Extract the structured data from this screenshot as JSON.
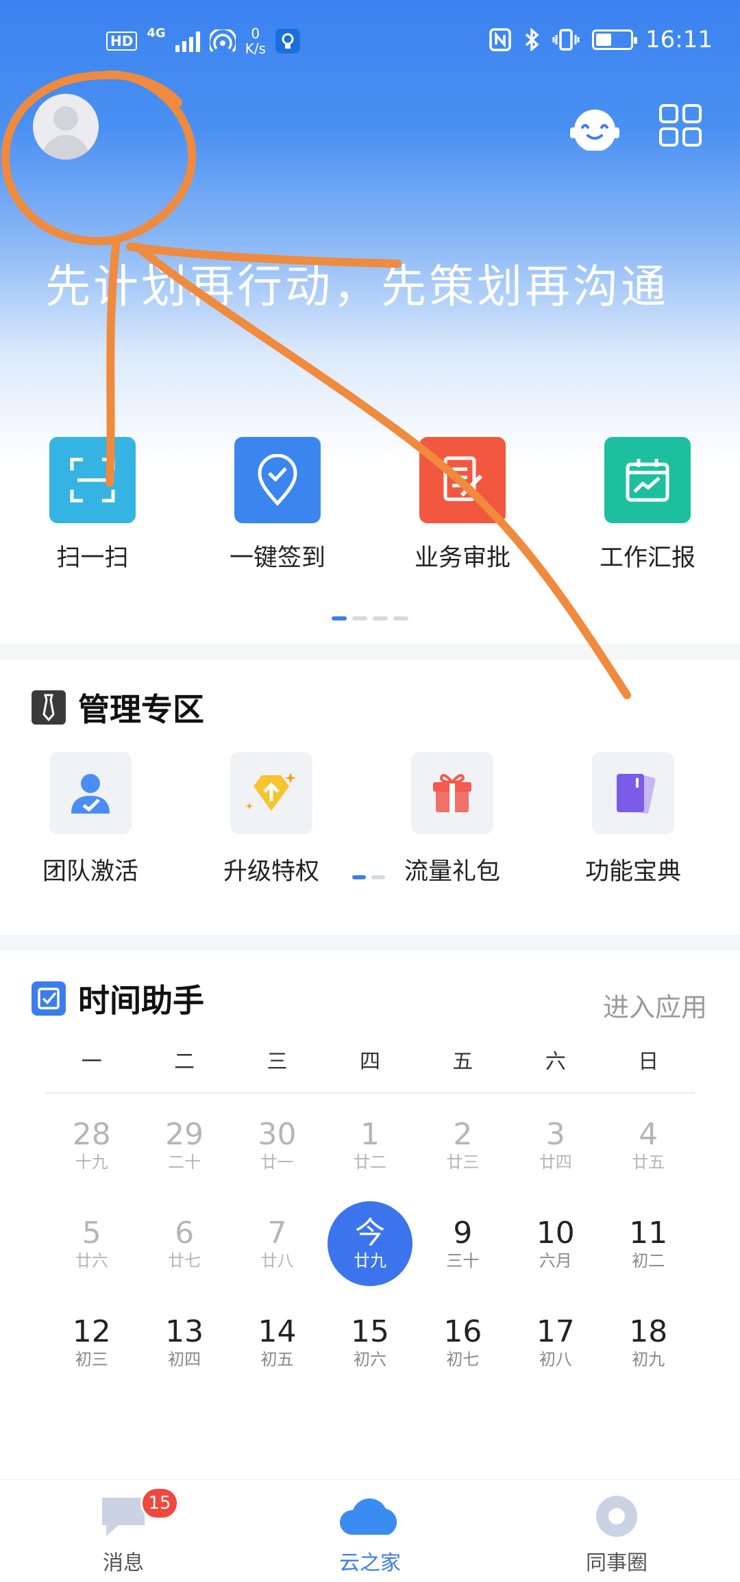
{
  "status_bar": {
    "hd": "HD",
    "network_type": "4G",
    "speed_value": "0",
    "speed_unit": "K/s",
    "time": "16:11",
    "battery_percent": 45
  },
  "header": {
    "slogan": "先计划再行动，先策划再沟通"
  },
  "quick_actions": [
    {
      "label": "扫一扫",
      "icon": "scan-icon",
      "color": "#35b3e2"
    },
    {
      "label": "一键签到",
      "icon": "location-check-icon",
      "color": "#3a86ee"
    },
    {
      "label": "业务审批",
      "icon": "document-edit-icon",
      "color": "#f2573f"
    },
    {
      "label": "工作汇报",
      "icon": "report-chart-icon",
      "color": "#1ebf9e"
    }
  ],
  "management": {
    "title": "管理专区",
    "items": [
      {
        "label": "团队激活",
        "icon": "user-check-icon"
      },
      {
        "label": "升级特权",
        "icon": "upgrade-diamond-icon"
      },
      {
        "label": "流量礼包",
        "icon": "gift-icon"
      },
      {
        "label": "功能宝典",
        "icon": "book-icon"
      }
    ]
  },
  "time_assistant": {
    "title": "时间助手",
    "enter_app": "进入应用",
    "weekdays": [
      "一",
      "二",
      "三",
      "四",
      "五",
      "六",
      "日"
    ],
    "weeks": [
      [
        {
          "d": "28",
          "l": "十九",
          "past": true
        },
        {
          "d": "29",
          "l": "二十",
          "past": true
        },
        {
          "d": "30",
          "l": "廿一",
          "past": true
        },
        {
          "d": "1",
          "l": "廿二",
          "past": true
        },
        {
          "d": "2",
          "l": "廿三",
          "past": true
        },
        {
          "d": "3",
          "l": "廿四",
          "past": true
        },
        {
          "d": "4",
          "l": "廿五",
          "past": true
        }
      ],
      [
        {
          "d": "5",
          "l": "廿六",
          "past": true
        },
        {
          "d": "6",
          "l": "廿七",
          "past": true
        },
        {
          "d": "7",
          "l": "廿八",
          "past": true
        },
        {
          "d": "今",
          "l": "廿九",
          "today": true
        },
        {
          "d": "9",
          "l": "三十"
        },
        {
          "d": "10",
          "l": "六月"
        },
        {
          "d": "11",
          "l": "初二"
        }
      ],
      [
        {
          "d": "12",
          "l": "初三"
        },
        {
          "d": "13",
          "l": "初四"
        },
        {
          "d": "14",
          "l": "初五"
        },
        {
          "d": "15",
          "l": "初六"
        },
        {
          "d": "16",
          "l": "初七"
        },
        {
          "d": "17",
          "l": "初八"
        },
        {
          "d": "18",
          "l": "初九"
        }
      ]
    ]
  },
  "tabbar": {
    "tabs": [
      {
        "label": "消息",
        "icon": "message-icon",
        "badge": "15"
      },
      {
        "label": "云之家",
        "icon": "cloud-icon",
        "active": true
      },
      {
        "label": "同事圈",
        "icon": "ring-icon"
      }
    ]
  },
  "colors": {
    "accent": "#3b7cf0",
    "annotation": "#f08a3c",
    "badge": "#f0473e"
  }
}
